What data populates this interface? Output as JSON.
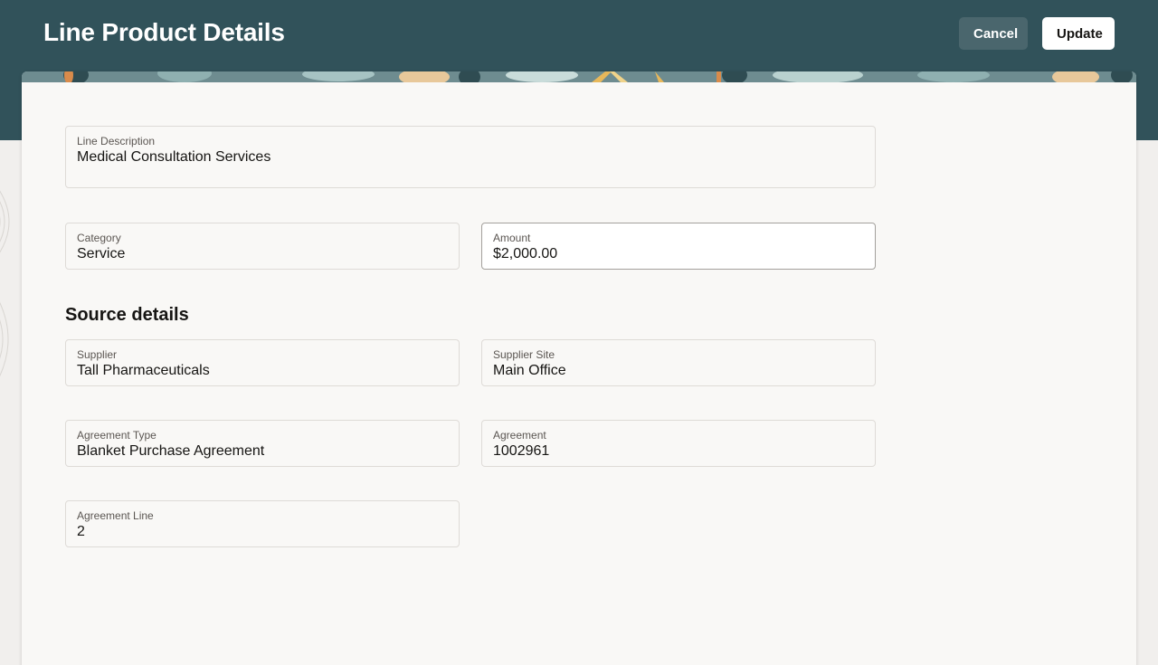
{
  "header": {
    "title": "Line Product Details",
    "cancel_label": "Cancel",
    "update_label": "Update"
  },
  "form": {
    "line_description": {
      "label": "Line Description",
      "value": "Medical Consultation Services"
    },
    "category": {
      "label": "Category",
      "value": "Service"
    },
    "amount": {
      "label": "Amount",
      "value": "$2,000.00"
    },
    "source_title": "Source details",
    "supplier": {
      "label": "Supplier",
      "value": "Tall Pharmaceuticals"
    },
    "supplier_site": {
      "label": "Supplier Site",
      "value": "Main Office"
    },
    "agreement_type": {
      "label": "Agreement Type",
      "value": "Blanket Purchase Agreement"
    },
    "agreement": {
      "label": "Agreement",
      "value": "1002961"
    },
    "agreement_line": {
      "label": "Agreement Line",
      "value": "2"
    }
  },
  "colors": {
    "header_bg": "#31525a",
    "cancel_bg": "#4a666d",
    "update_bg": "#ffffff",
    "card_bg": "#f9f8f6"
  }
}
